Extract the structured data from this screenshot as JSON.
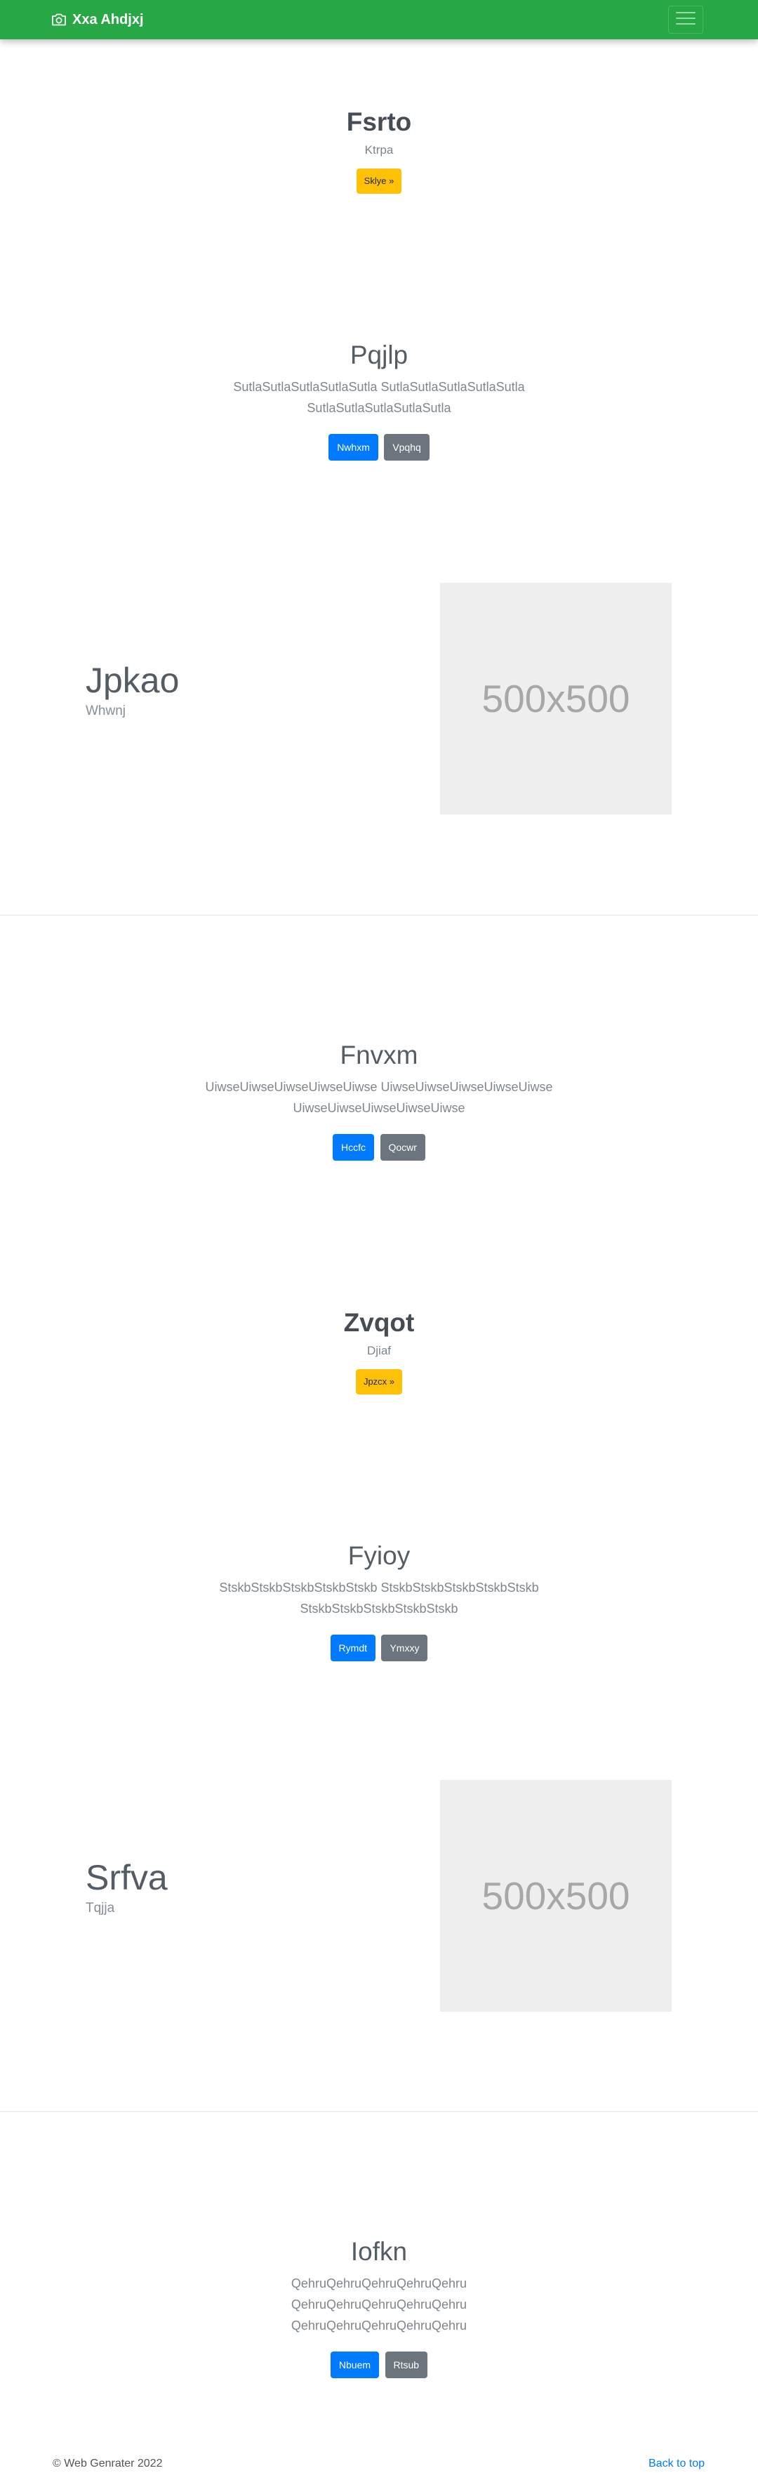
{
  "navbar": {
    "brand": "Xxa Ahdjxj",
    "brand_icon": "camera-icon",
    "toggler_icon": "hamburger-menu-icon",
    "colors": {
      "background": "#28a745",
      "text": "#ffffff"
    }
  },
  "hero1": {
    "title": "Fsrto",
    "subtitle": "Ktrpa",
    "button": "Sklye »"
  },
  "block1": {
    "title": "Pqjlp",
    "text_line1": "SutlaSutlaSutlaSutlaSutla SutlaSutlaSutlaSutlaSutla",
    "text_line2": "SutlaSutlaSutlaSutlaSutla",
    "primary_button": "Nwhxm",
    "secondary_button": "Vpqhq"
  },
  "feature1": {
    "title": "Jpkao",
    "subtitle": "Whwnj",
    "image_label": "500x500"
  },
  "block2": {
    "title": "Fnvxm",
    "text_line1": "UiwseUiwseUiwseUiwseUiwse UiwseUiwseUiwseUiwseUiwse",
    "text_line2": "UiwseUiwseUiwseUiwseUiwse",
    "primary_button": "Hccfc",
    "secondary_button": "Qocwr"
  },
  "hero2": {
    "title": "Zvqot",
    "subtitle": "Djiaf",
    "button": "Jpzcx »"
  },
  "block3": {
    "title": "Fyioy",
    "text_line1": "StskbStskbStskbStskbStskb StskbStskbStskbStskbStskb",
    "text_line2": "StskbStskbStskbStskbStskb",
    "primary_button": "Rymdt",
    "secondary_button": "Ymxxy"
  },
  "feature2": {
    "title": "Srfva",
    "subtitle": "Tqjja",
    "image_label": "500x500"
  },
  "block4": {
    "title": "Iofkn",
    "text_line1": "QehruQehruQehruQehruQehru",
    "text_line2": "QehruQehruQehruQehruQehru",
    "text_line3": "QehruQehruQehruQehruQehru",
    "primary_button": "Nbuem",
    "secondary_button": "Rtsub"
  },
  "footer": {
    "copyright": "© Web Genrater 2022",
    "back_to_top": "Back to top"
  },
  "colors": {
    "primary": "#007bff",
    "secondary": "#6c757d",
    "warning": "#ffc107",
    "placeholder_bg": "#eeeeee"
  }
}
